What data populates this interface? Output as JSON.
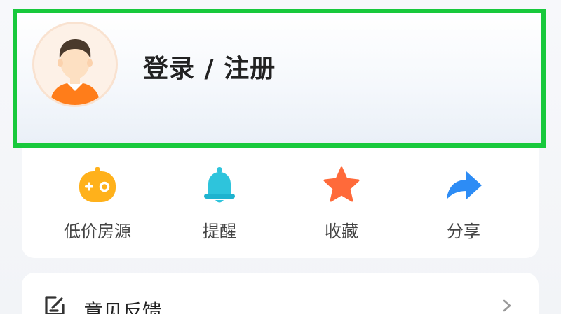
{
  "profile": {
    "login_label": "登录 / 注册"
  },
  "actions": [
    {
      "label": "低价房源",
      "icon": "ticket-icon",
      "color": "#ffb11b"
    },
    {
      "label": "提醒",
      "icon": "bell-icon",
      "color": "#2ec4dc"
    },
    {
      "label": "收藏",
      "icon": "star-icon",
      "color": "#ff6a3a"
    },
    {
      "label": "分享",
      "icon": "share-arrow-icon",
      "color": "#2d8cf5"
    }
  ],
  "feedback": {
    "label": "意见反馈",
    "icon": "edit-note-icon"
  },
  "colors": {
    "highlight_border": "#18c93c"
  }
}
